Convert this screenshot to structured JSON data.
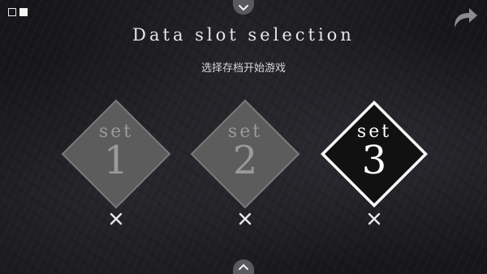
{
  "header": {
    "title": "Data slot selection",
    "subtitle": "选择存档开始游戏"
  },
  "slots": [
    {
      "label": "set",
      "number": "1",
      "state": "inactive"
    },
    {
      "label": "set",
      "number": "2",
      "state": "inactive"
    },
    {
      "label": "set",
      "number": "3",
      "state": "selected"
    }
  ],
  "icons": {
    "mode_toggle": [
      "square-outline-icon",
      "square-filled-icon"
    ],
    "nav_up": "chevron-down-icon",
    "nav_down": "chevron-up-icon",
    "back": "curved-arrow-icon",
    "delete": "close-icon"
  },
  "colors": {
    "background": "#17171b",
    "slot_inactive_fill": "#5c5c5c",
    "slot_inactive_text": "#9a9a9a",
    "slot_active_fill": "#111111",
    "slot_active_border": "#ffffff",
    "text": "#e6e6e6"
  }
}
